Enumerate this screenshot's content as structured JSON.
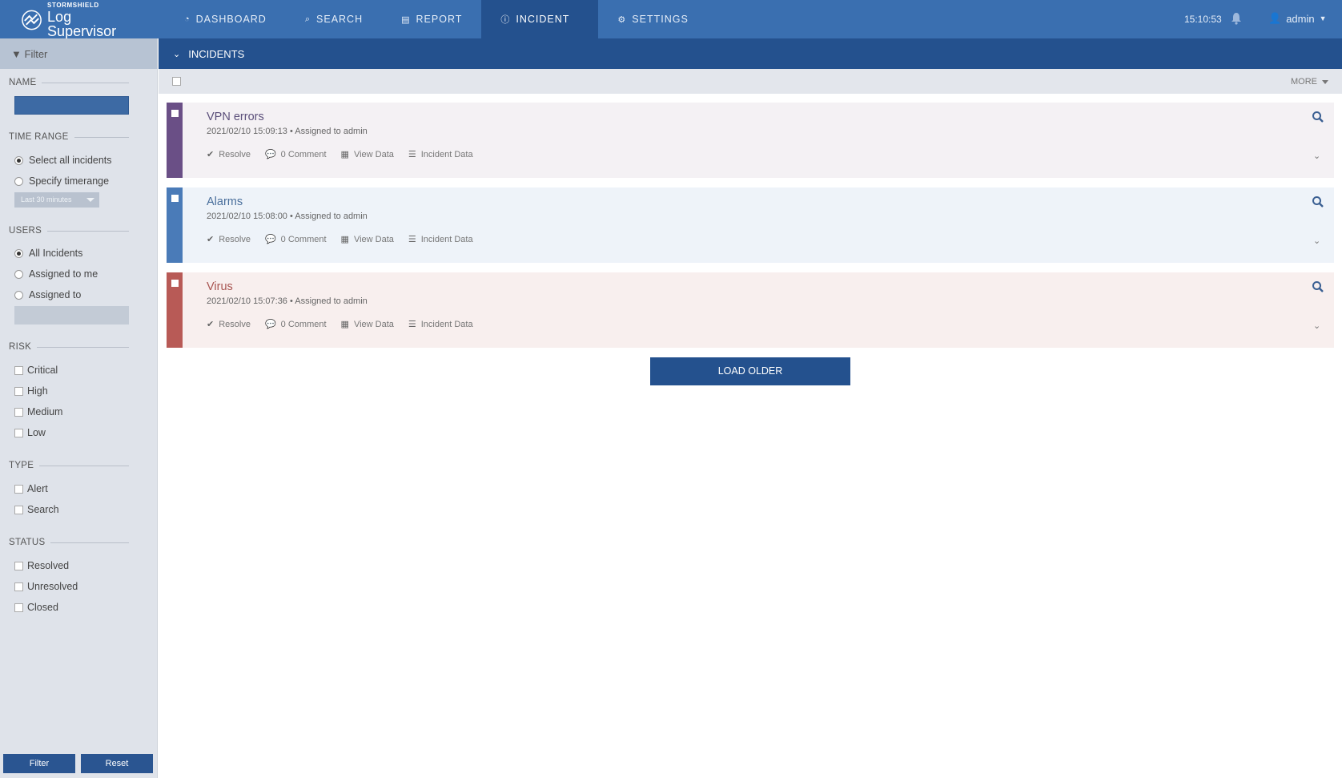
{
  "app": {
    "brand": "STORMSHIELD",
    "product": "Log Supervisor"
  },
  "nav": {
    "items": [
      {
        "label": "DASHBOARD",
        "icon": "dashboard-icon"
      },
      {
        "label": "SEARCH",
        "icon": "search-icon"
      },
      {
        "label": "REPORT",
        "icon": "report-icon"
      },
      {
        "label": "INCIDENT",
        "icon": "info-icon",
        "active": true
      },
      {
        "label": "SETTINGS",
        "icon": "gear-icon"
      }
    ]
  },
  "header": {
    "time": "15:10:53",
    "user": "admin"
  },
  "sidebar": {
    "title": "Filter",
    "name_label": "NAME",
    "name_value": "",
    "time_range_label": "TIME RANGE",
    "time_options": [
      "Select all incidents",
      "Specify timerange"
    ],
    "time_selected": "Select all incidents",
    "timerange_select": "Last 30 minutes",
    "users_label": "USERS",
    "user_options": [
      "All Incidents",
      "Assigned to me",
      "Assigned to"
    ],
    "user_selected": "All Incidents",
    "risk_label": "RISK",
    "risk_options": [
      "Critical",
      "High",
      "Medium",
      "Low"
    ],
    "type_label": "TYPE",
    "type_options": [
      "Alert",
      "Search"
    ],
    "status_label": "STATUS",
    "status_options": [
      "Resolved",
      "Unresolved",
      "Closed"
    ],
    "filter_button": "Filter",
    "reset_button": "Reset"
  },
  "main": {
    "section_title": "INCIDENTS",
    "more_label": "MORE",
    "actions": {
      "resolve": "Resolve",
      "comment": "0 Comment",
      "view_data": "View Data",
      "incident_data": "Incident Data"
    },
    "incidents": [
      {
        "title": "VPN errors",
        "meta": "2021/02/10 15:09:13 • Assigned to admin",
        "color": "#6a4f86",
        "bg": "#f4f1f4",
        "title_color": "#5b4f7a"
      },
      {
        "title": "Alarms",
        "meta": "2021/02/10 15:08:00 • Assigned to admin",
        "color": "#4a7bb8",
        "bg": "#eef3f9",
        "title_color": "#4a6f9c"
      },
      {
        "title": "Virus",
        "meta": "2021/02/10 15:07:36 • Assigned to admin",
        "color": "#b85a56",
        "bg": "#f8efee",
        "title_color": "#a85450"
      }
    ],
    "load_older": "LOAD OLDER"
  }
}
